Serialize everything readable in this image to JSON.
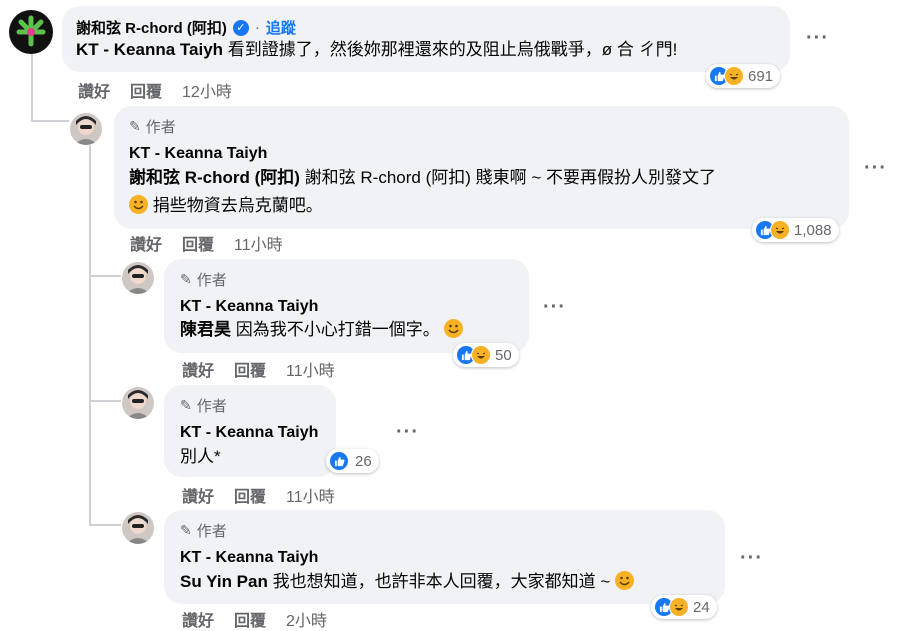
{
  "top": {
    "name": "謝和弦 R-chord (阿扣)",
    "follow": "追蹤",
    "mention": "KT - Keanna Taiyh",
    "text": "看到證據了，然後妳那裡還來的及阻止烏俄戰爭，ø 合 ㄔ門!",
    "like": "讚好",
    "reply": "回覆",
    "time": "12小時",
    "reactions": "691"
  },
  "c1": {
    "author_tag": "作者",
    "name": "KT - Keanna Taiyh",
    "mention": "謝和弦 R-chord (阿扣)",
    "text1": "謝和弦 R-chord (阿扣) 賤東啊 ~ 不要再假扮人別發文了",
    "text2": "捐些物資去烏克蘭吧。",
    "like": "讚好",
    "reply": "回覆",
    "time": "11小時",
    "reactions": "1,088"
  },
  "c2": {
    "author_tag": "作者",
    "name": "KT - Keanna Taiyh",
    "mention": "陳君昊",
    "text": "因為我不小心打錯一個字。",
    "like": "讚好",
    "reply": "回覆",
    "time": "11小時",
    "reactions": "50"
  },
  "c3": {
    "author_tag": "作者",
    "name": "KT - Keanna Taiyh",
    "text": "別人*",
    "like": "讚好",
    "reply": "回覆",
    "time": "11小時",
    "reactions": "26"
  },
  "c4": {
    "author_tag": "作者",
    "name": "KT - Keanna Taiyh",
    "mention": "Su Yin Pan",
    "text": "我也想知道，也許非本人回覆，大家都知道 ~",
    "like": "讚好",
    "reply": "回覆",
    "time": "2小時",
    "reactions": "24"
  },
  "colors": {
    "bubble": "#f0f2f5",
    "like": "#1877f2",
    "haha": "#f7b125",
    "muted": "#65676b"
  }
}
